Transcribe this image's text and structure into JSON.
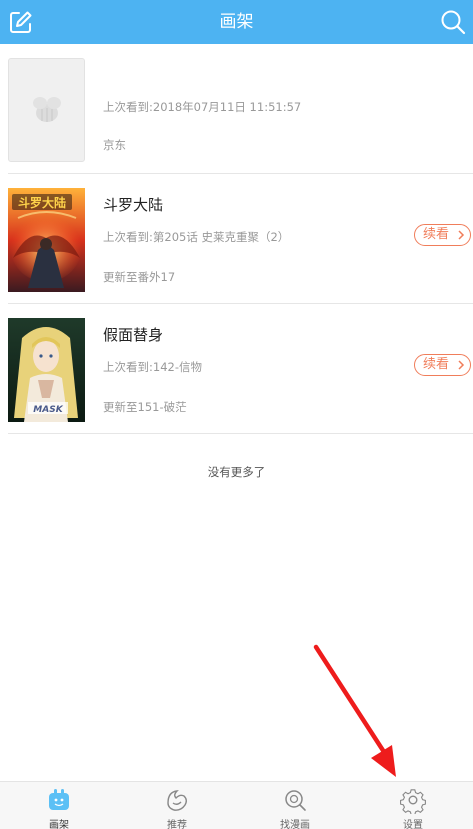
{
  "header": {
    "title": "画架",
    "edit_icon": "edit-icon",
    "search_icon": "search-icon",
    "color": "#4db3f2"
  },
  "books": [
    {
      "name": "",
      "last_read": "上次看到:2018年07月11日 11:51:57",
      "update": "京东",
      "continue_label": ""
    },
    {
      "name": "斗罗大陆",
      "last_read": "上次看到:第205话 史莱克重聚（2）",
      "update": "更新至番外17",
      "continue_label": "续看"
    },
    {
      "name": "假面替身",
      "last_read": "上次看到:142-信物",
      "update": "更新至151-破茫",
      "continue_label": "续看"
    }
  ],
  "footer_note": "没有更多了",
  "tabs": [
    {
      "label": "画架",
      "icon": "bookshelf-icon"
    },
    {
      "label": "推荐",
      "icon": "recommend-icon"
    },
    {
      "label": "找漫画",
      "icon": "find-comic-icon"
    },
    {
      "label": "设置",
      "icon": "settings-icon"
    }
  ],
  "accent_color": "#f07d5a",
  "annotation_color": "#ee1c1c"
}
